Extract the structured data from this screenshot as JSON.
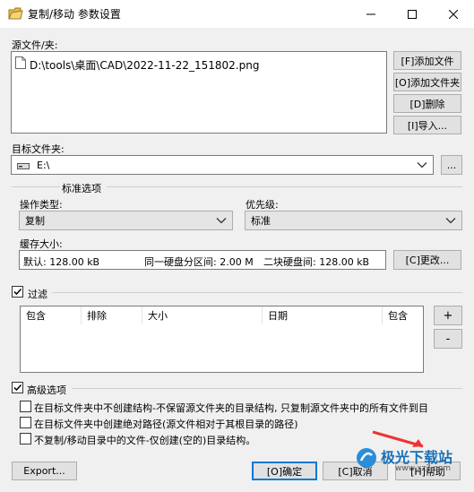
{
  "window": {
    "title": "复制/移动 参数设置"
  },
  "source": {
    "label": "源文件/夹:",
    "files": [
      "D:\\tools\\桌面\\CAD\\2022-11-22_151802.png"
    ],
    "add_file": "[F]添加文件",
    "add_folder": "[O]添加文件夹",
    "delete": "[D]删除",
    "import": "[I]导入..."
  },
  "target": {
    "label": "目标文件夹:",
    "value": "E:\\",
    "browse": "..."
  },
  "standard_options": {
    "group_label": "标准选项",
    "operation_label": "操作类型:",
    "operation_value": "复制",
    "priority_label": "优先级:",
    "priority_value": "标准",
    "cache_label": "缓存大小:",
    "cache_default": "默认: 128.00 kB",
    "cache_same": "同一硬盘分区间: 2.00 M",
    "cache_two": "二块硬盘间: 128.00 kB",
    "change": "[C]更改..."
  },
  "filter": {
    "label": "过滤",
    "checked": true,
    "columns": [
      "包含",
      "排除",
      "大小",
      "日期",
      "包含"
    ],
    "add": "+",
    "remove": "-"
  },
  "advanced": {
    "label": "高级选项",
    "checked": true,
    "options": [
      "在目标文件夹中不创建结构-不保留源文件夹的目录结构, 只复制源文件夹中的所有文件到目",
      "在目标文件夹中创建绝对路径(源文件相对于其根目录的路径)",
      "不复制/移动目录中的文件-仅创建(空的)目录结构。"
    ]
  },
  "footer": {
    "export": "Export...",
    "ok": "[O]确定",
    "cancel": "[C]取消",
    "help": "[H]帮助"
  },
  "watermark": {
    "text": "极光下载站",
    "url": "www.xz7.com"
  }
}
